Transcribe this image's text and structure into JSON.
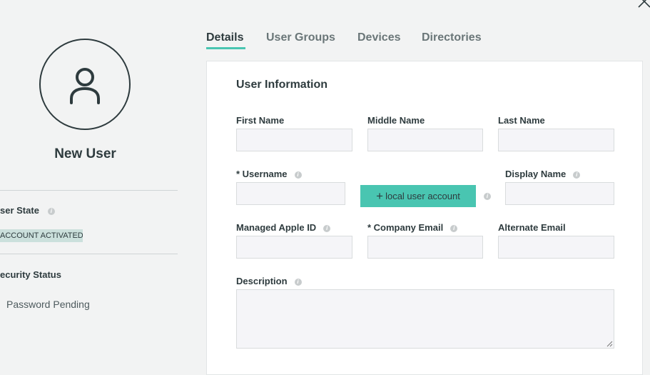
{
  "user": {
    "name": "New User"
  },
  "sidebar": {
    "user_state_label": "ser State",
    "user_state_badge": "ACCOUNT ACTIVATED",
    "security_status_label": "ecurity Status",
    "security_status_value": "Password Pending"
  },
  "tabs": [
    {
      "label": "Details",
      "active": true
    },
    {
      "label": "User Groups",
      "active": false
    },
    {
      "label": "Devices",
      "active": false
    },
    {
      "label": "Directories",
      "active": false
    }
  ],
  "form": {
    "section_title": "User Information",
    "first_name": {
      "label": "First Name",
      "value": ""
    },
    "middle_name": {
      "label": "Middle Name",
      "value": ""
    },
    "last_name": {
      "label": "Last Name",
      "value": ""
    },
    "username": {
      "label": "* Username",
      "value": ""
    },
    "local_user_button": "local user account",
    "display_name": {
      "label": "Display Name",
      "value": ""
    },
    "managed_apple_id": {
      "label": "Managed Apple ID",
      "value": ""
    },
    "company_email": {
      "label": "* Company Email",
      "value": ""
    },
    "alternate_email": {
      "label": "Alternate Email",
      "value": ""
    },
    "description": {
      "label": "Description",
      "value": ""
    }
  },
  "colors": {
    "accent": "#49c5b1",
    "badge_bg": "#cbe0dc",
    "text": "#2e3b3e",
    "page_bg": "#f2f3f3"
  },
  "icons": {
    "close": "close-icon",
    "avatar": "user-icon",
    "info": "info-icon",
    "plus": "plus-icon"
  }
}
